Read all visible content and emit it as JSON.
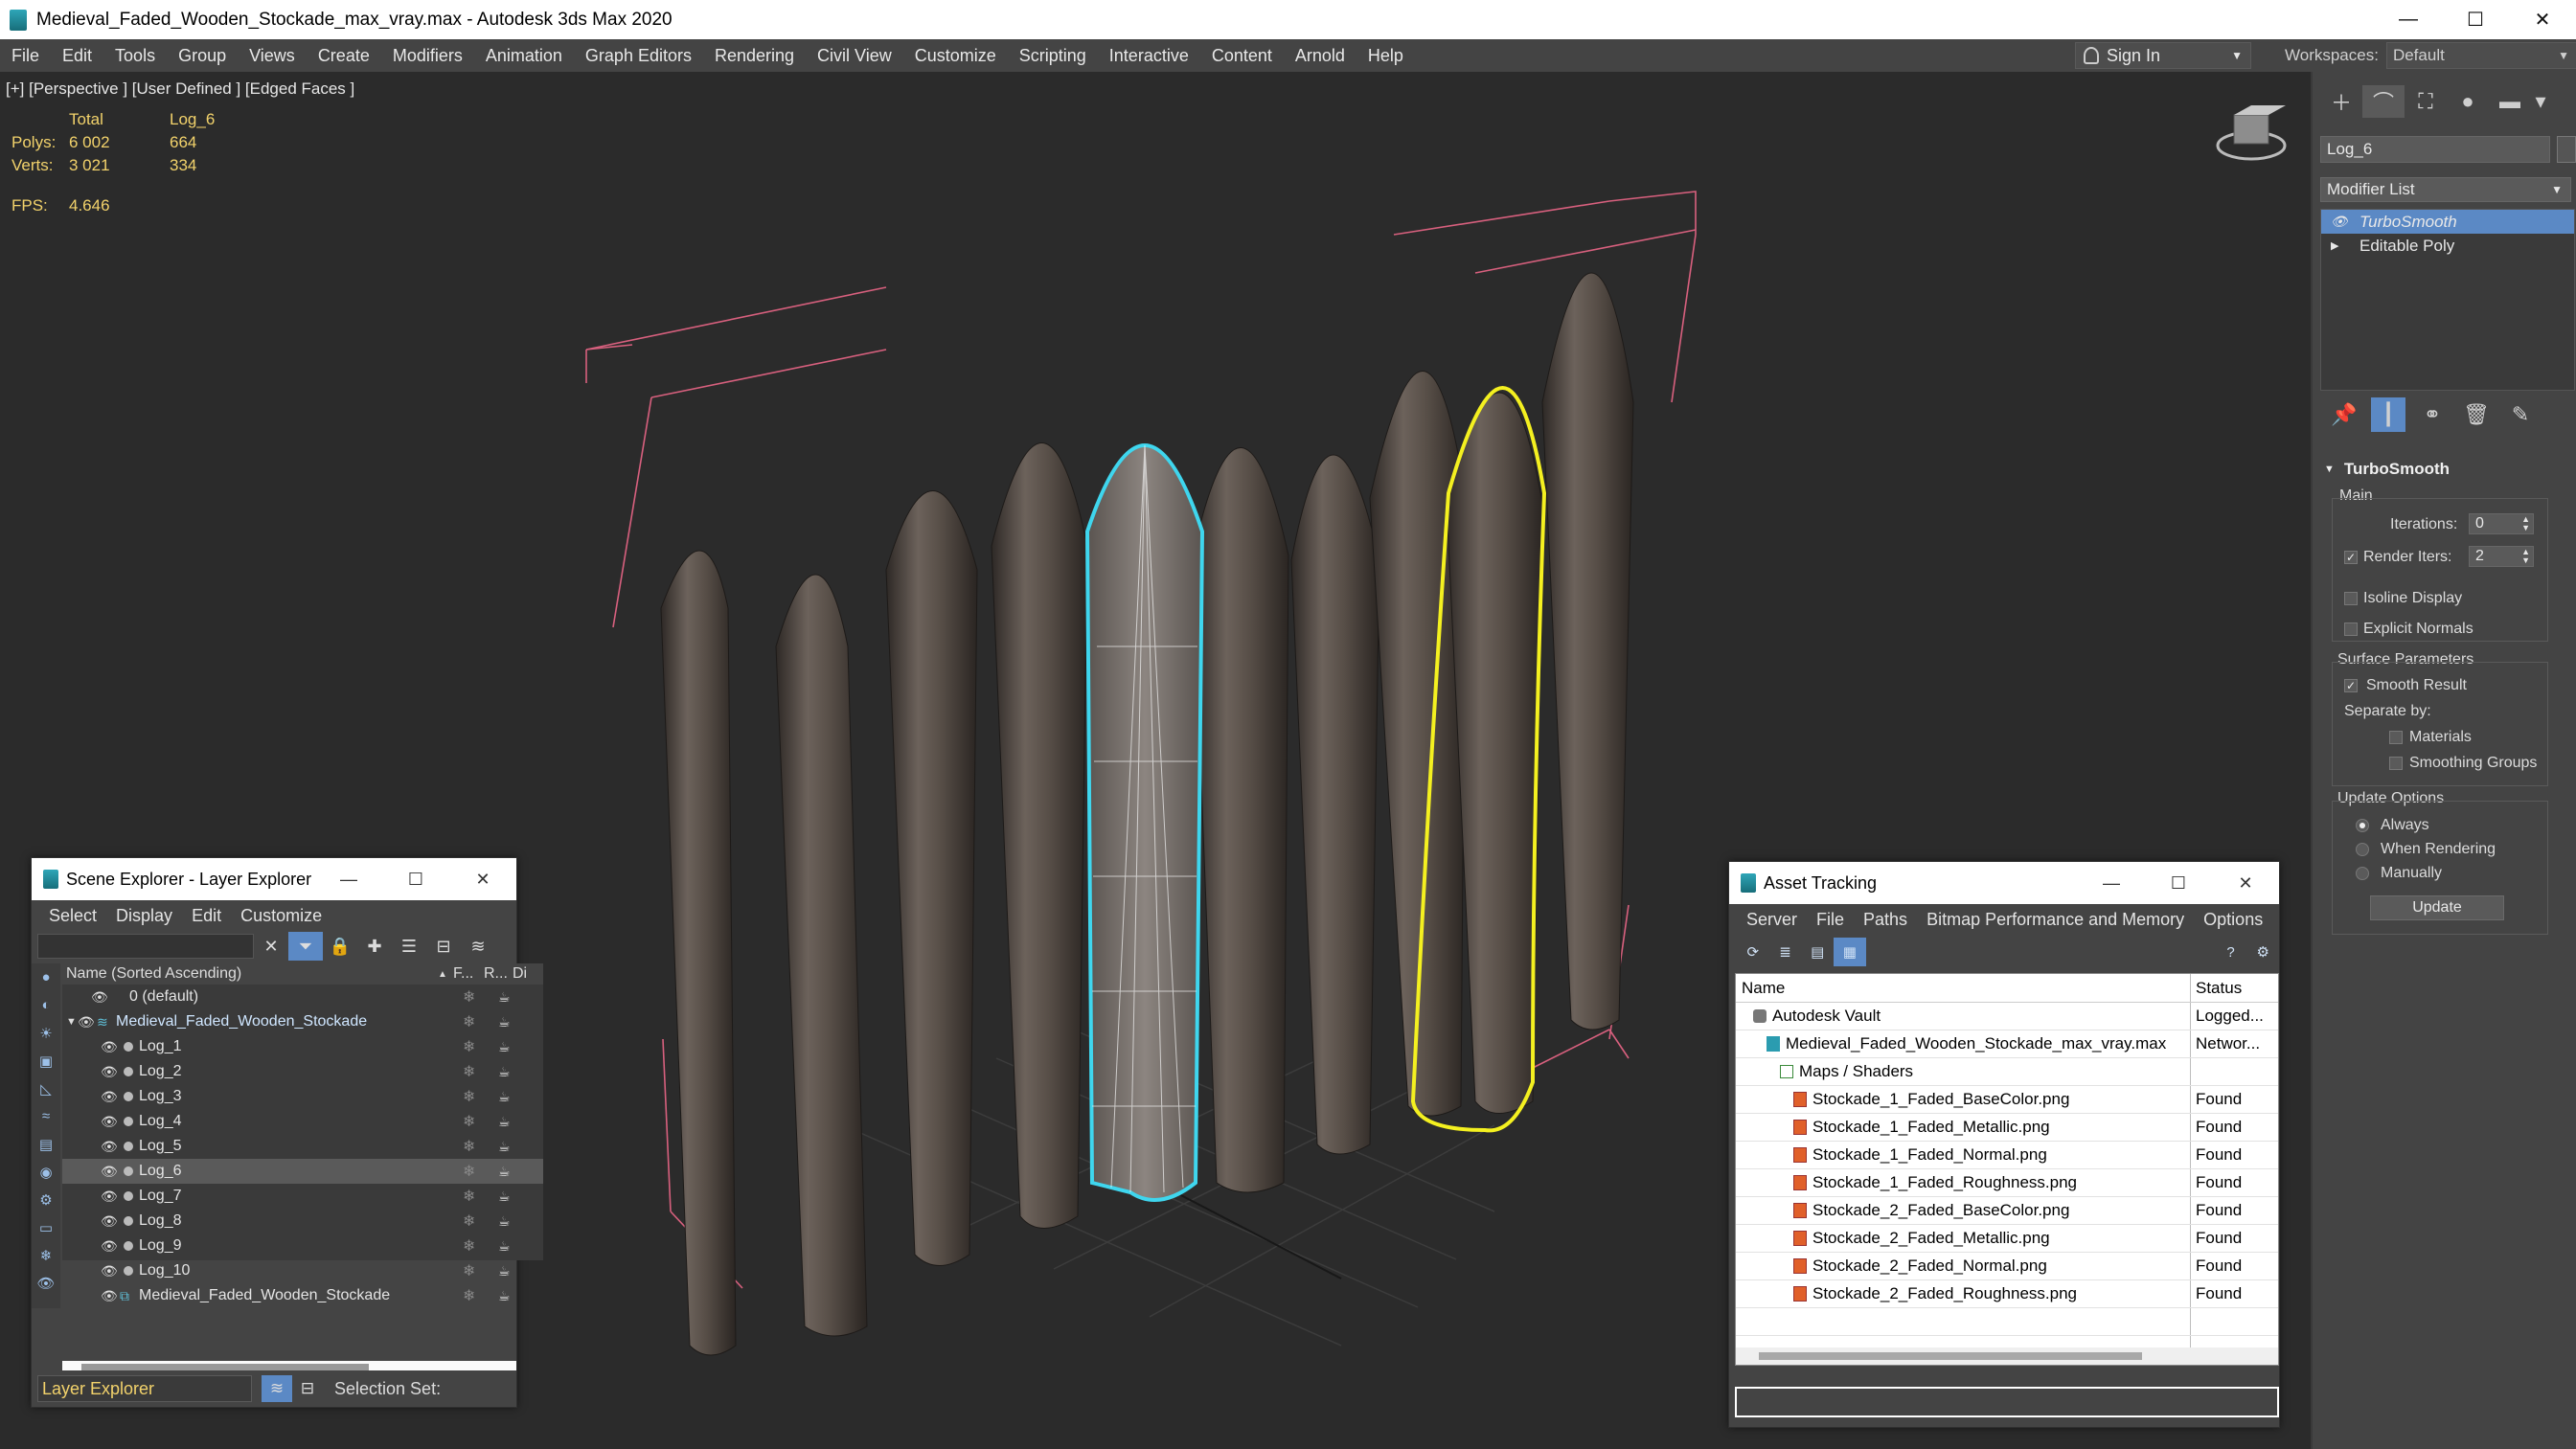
{
  "window": {
    "title": "Medieval_Faded_Wooden_Stockade_max_vray.max - Autodesk 3ds Max 2020",
    "minimize": "—",
    "maximize": "☐",
    "close": "✕"
  },
  "menubar": {
    "items": [
      "File",
      "Edit",
      "Tools",
      "Group",
      "Views",
      "Create",
      "Modifiers",
      "Animation",
      "Graph Editors",
      "Rendering",
      "Civil View",
      "Customize",
      "Scripting",
      "Interactive",
      "Content",
      "Arnold",
      "Help"
    ],
    "sign_in": "Sign In",
    "workspaces_label": "Workspaces:",
    "workspace_value": "Default"
  },
  "viewport": {
    "label": "[+] [Perspective ] [User Defined ] [Edged Faces ]",
    "stats": {
      "header": [
        "",
        "Total",
        "Log_6"
      ],
      "rows": [
        {
          "label": "Polys:",
          "total": "6 002",
          "selected": "664"
        },
        {
          "label": "Verts:",
          "total": "3 021",
          "selected": "334"
        }
      ]
    },
    "fps_label": "FPS:",
    "fps_value": "4.646"
  },
  "command_panel": {
    "object_name": "Log_6",
    "modifier_list": "Modifier List",
    "stack": [
      {
        "label": "TurboSmooth",
        "selected": true
      },
      {
        "label": "Editable Poly",
        "selected": false
      }
    ],
    "rollout_title": "TurboSmooth",
    "main_label": "Main",
    "iterations_label": "Iterations:",
    "iterations_value": "0",
    "render_iters_label": "Render Iters:",
    "render_iters_value": "2",
    "render_iters_checked": true,
    "isoline_label": "Isoline Display",
    "explicit_normals_label": "Explicit Normals",
    "surface_params_label": "Surface Parameters",
    "smooth_result_label": "Smooth Result",
    "smooth_result_checked": true,
    "separate_by_label": "Separate by:",
    "materials_label": "Materials",
    "smoothing_groups_label": "Smoothing Groups",
    "update_options_label": "Update Options",
    "always_label": "Always",
    "when_rendering_label": "When Rendering",
    "manually_label": "Manually",
    "update_button": "Update",
    "selected_update_option": "Always"
  },
  "scene_explorer": {
    "title": "Scene Explorer - Layer Explorer",
    "menu": [
      "Select",
      "Display",
      "Edit",
      "Customize"
    ],
    "columns": {
      "name": "Name (Sorted Ascending)",
      "frozen": "F...",
      "render": "R...",
      "display": "Di"
    },
    "rows": [
      {
        "name": "0 (default)",
        "indent": 1,
        "type": "layer",
        "selected": false
      },
      {
        "name": "Medieval_Faded_Wooden_Stockade",
        "indent": 0,
        "type": "layer-active",
        "selected": false
      },
      {
        "name": "Log_1",
        "indent": 2,
        "type": "object",
        "selected": false
      },
      {
        "name": "Log_2",
        "indent": 2,
        "type": "object",
        "selected": false
      },
      {
        "name": "Log_3",
        "indent": 2,
        "type": "object",
        "selected": false
      },
      {
        "name": "Log_4",
        "indent": 2,
        "type": "object",
        "selected": false
      },
      {
        "name": "Log_5",
        "indent": 2,
        "type": "object",
        "selected": false
      },
      {
        "name": "Log_6",
        "indent": 2,
        "type": "object",
        "selected": true
      },
      {
        "name": "Log_7",
        "indent": 2,
        "type": "object",
        "selected": false
      },
      {
        "name": "Log_8",
        "indent": 2,
        "type": "object",
        "selected": false
      },
      {
        "name": "Log_9",
        "indent": 2,
        "type": "object",
        "selected": false
      },
      {
        "name": "Log_10",
        "indent": 2,
        "type": "object",
        "selected": false
      },
      {
        "name": "Medieval_Faded_Wooden_Stockade",
        "indent": 2,
        "type": "group",
        "selected": false
      }
    ],
    "layer_explorer": "Layer Explorer",
    "selection_set_label": "Selection Set:"
  },
  "asset_tracking": {
    "title": "Asset Tracking",
    "menu": [
      "Server",
      "File",
      "Paths",
      "Bitmap Performance and Memory",
      "Options"
    ],
    "columns": {
      "name": "Name",
      "status": "Status"
    },
    "rows": [
      {
        "name": "Autodesk Vault",
        "status": "Logged...",
        "icon": "vault",
        "indent": 0
      },
      {
        "name": "Medieval_Faded_Wooden_Stockade_max_vray.max",
        "status": "Networ...",
        "icon": "max",
        "indent": 1
      },
      {
        "name": "Maps / Shaders",
        "status": "",
        "icon": "folder",
        "indent": 2
      },
      {
        "name": "Stockade_1_Faded_BaseColor.png",
        "status": "Found",
        "icon": "file",
        "indent": 3
      },
      {
        "name": "Stockade_1_Faded_Metallic.png",
        "status": "Found",
        "icon": "file",
        "indent": 3
      },
      {
        "name": "Stockade_1_Faded_Normal.png",
        "status": "Found",
        "icon": "file",
        "indent": 3
      },
      {
        "name": "Stockade_1_Faded_Roughness.png",
        "status": "Found",
        "icon": "file",
        "indent": 3
      },
      {
        "name": "Stockade_2_Faded_BaseColor.png",
        "status": "Found",
        "icon": "file",
        "indent": 3
      },
      {
        "name": "Stockade_2_Faded_Metallic.png",
        "status": "Found",
        "icon": "file",
        "indent": 3
      },
      {
        "name": "Stockade_2_Faded_Normal.png",
        "status": "Found",
        "icon": "file",
        "indent": 3
      },
      {
        "name": "Stockade_2_Faded_Roughness.png",
        "status": "Found",
        "icon": "file",
        "indent": 3
      }
    ]
  },
  "colors": {
    "selection_cyan": "#3fd6ee",
    "highlight_yellow": "#f4f020",
    "bbox_pink": "#d8607e",
    "accent_blue": "#5b89c5",
    "stats_yellow": "#f2d26b"
  }
}
